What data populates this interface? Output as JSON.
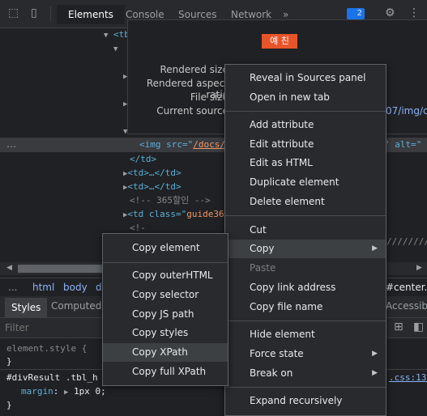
{
  "tabs": {
    "elements": "Elements",
    "console": "Console",
    "sources": "Sources",
    "network": "Network",
    "more": "»",
    "badge": "2"
  },
  "tree": {
    "tb_prefix": "<tb",
    "img_line": {
      "open": "<img src=\"",
      "src": "/docs/",
      "end": "\" alt=\""
    },
    "line_td_close": "</td>",
    "line_td1": "<td>…</td>",
    "line_td2": "<td>…</td>",
    "comment1": "<!-- 365할인 -->",
    "td_class_open": "<td class=\"",
    "td_class_val": "guide36",
    "comment2": "<!-",
    "slashes": "////////"
  },
  "popup": {
    "badge": "예 친",
    "labels": [
      "Rendered size",
      "Rendered aspect ratio",
      "File size",
      "Current source"
    ],
    "current_source_tail": "07/img/c"
  },
  "breadcrumb": {
    "items": [
      "html",
      "body",
      "d"
    ],
    "dots": "...",
    "tail": "#center.c"
  },
  "styles_tabs": {
    "styles": "Styles",
    "computed": "Computed",
    "accessibility": "Accessibil"
  },
  "filter": {
    "placeholder": "Filter"
  },
  "styles_pane": {
    "element_style": "element.style {",
    "close1": "}",
    "rule_selector": "#divResult .tbl_h",
    "rule_prop": "margin",
    "rule_val": "1px 0;",
    "rule_source": ".css:133",
    "close2": "}"
  },
  "main_menu": {
    "items": [
      "Reveal in Sources panel",
      "Open in new tab",
      "Add attribute",
      "Edit attribute",
      "Edit as HTML",
      "Duplicate element",
      "Delete element",
      "Cut",
      "Copy",
      "Paste",
      "Copy link address",
      "Copy file name",
      "Hide element",
      "Force state",
      "Break on",
      "Expand recursively"
    ]
  },
  "copy_menu": {
    "items": [
      "Copy element",
      "Copy outerHTML",
      "Copy selector",
      "Copy JS path",
      "Copy styles",
      "Copy XPath",
      "Copy full XPath"
    ]
  }
}
